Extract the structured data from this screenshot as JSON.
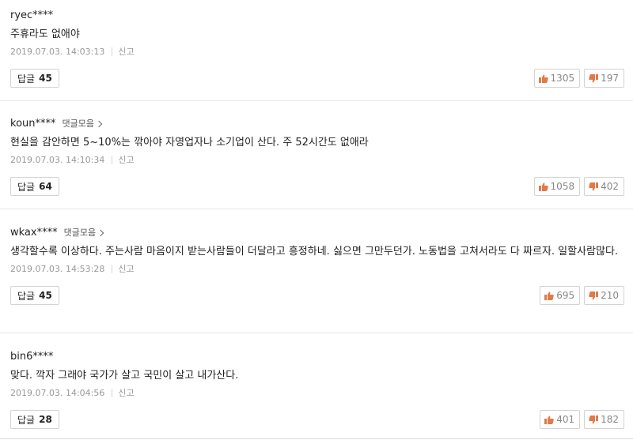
{
  "comments": [
    {
      "author": "ryec****",
      "more_label": "",
      "text": "주휴라도 없애야",
      "timestamp": "2019.07.03. 14:03:13",
      "report_label": "신고",
      "reply_label": "답글",
      "reply_count": "45",
      "likes": "1305",
      "dislikes": "197"
    },
    {
      "author": "koun****",
      "more_label": "댓글모음",
      "text": "현실을 감안하면 5~10%는 깎아야 자영업자나 소기업이 산다. 주 52시간도 없애라",
      "timestamp": "2019.07.03. 14:10:34",
      "report_label": "신고",
      "reply_label": "답글",
      "reply_count": "64",
      "likes": "1058",
      "dislikes": "402"
    },
    {
      "author": "wkax****",
      "more_label": "댓글모음",
      "text": "생각할수록 이상하다. 주는사람 마음이지 받는사람들이 더달라고 흥정하네. 싫으면 그만두던가. 노동법을 고쳐서라도 다 짜르자. 일할사람많다.",
      "timestamp": "2019.07.03. 14:53:28",
      "report_label": "신고",
      "reply_label": "답글",
      "reply_count": "45",
      "likes": "695",
      "dislikes": "210"
    },
    {
      "author": "bin6****",
      "more_label": "",
      "text": "맞다. 깍자 그래야 국가가 살고 국민이 살고 내가산다.",
      "timestamp": "2019.07.03. 14:04:56",
      "report_label": "신고",
      "reply_label": "답글",
      "reply_count": "28",
      "likes": "401",
      "dislikes": "182"
    }
  ]
}
